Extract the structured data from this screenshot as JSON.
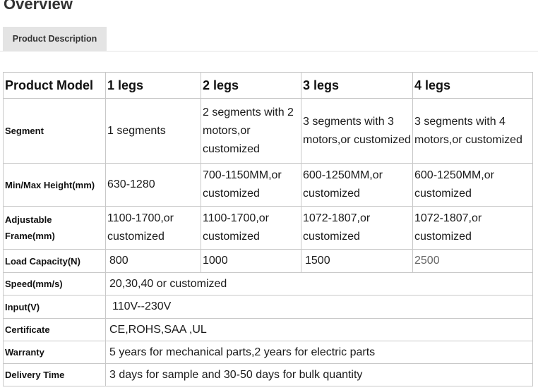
{
  "page": {
    "title": "Overview"
  },
  "tabs": [
    {
      "label": "Product Description"
    }
  ],
  "table": {
    "header": [
      "Product Model",
      "1 legs",
      "2 legs",
      "3 legs",
      "4 legs"
    ],
    "rows": {
      "segment": {
        "label": "Segment",
        "values": [
          "1 segments",
          "2 segments with 2 motors,or customized",
          "3 segments with 3 motors,or customized",
          "3 segments with 4 motors,or customized"
        ]
      },
      "height": {
        "label": "Min/Max Height(mm)",
        "values": [
          "630-1280",
          "700-1150MM,or customized",
          "600-1250MM,or customized",
          "600-1250MM,or customized"
        ]
      },
      "frame": {
        "label": "Adjustable Frame(mm)",
        "values": [
          "1100-1700,or customized",
          "1100-1700,or customized",
          "1072-1807,or customized",
          "1072-1807,or customized"
        ]
      },
      "load": {
        "label": "Load Capacity(N)",
        "values": [
          "800",
          "1000",
          "1500",
          "2500"
        ]
      },
      "speed": {
        "label": "Speed(mm/s)",
        "value": "20,30,40 or customized"
      },
      "input": {
        "label": "Input(V)",
        "value": "110V--230V"
      },
      "certificate": {
        "label": "Certificate",
        "value": "CE,ROHS,SAA ,UL"
      },
      "warranty": {
        "label": "Warranty",
        "value": "5 years for mechanical parts,2 years for electric parts"
      },
      "delivery": {
        "label": "Delivery Time",
        "value": "3 days for sample and 30-50 days for bulk quantity"
      }
    }
  }
}
